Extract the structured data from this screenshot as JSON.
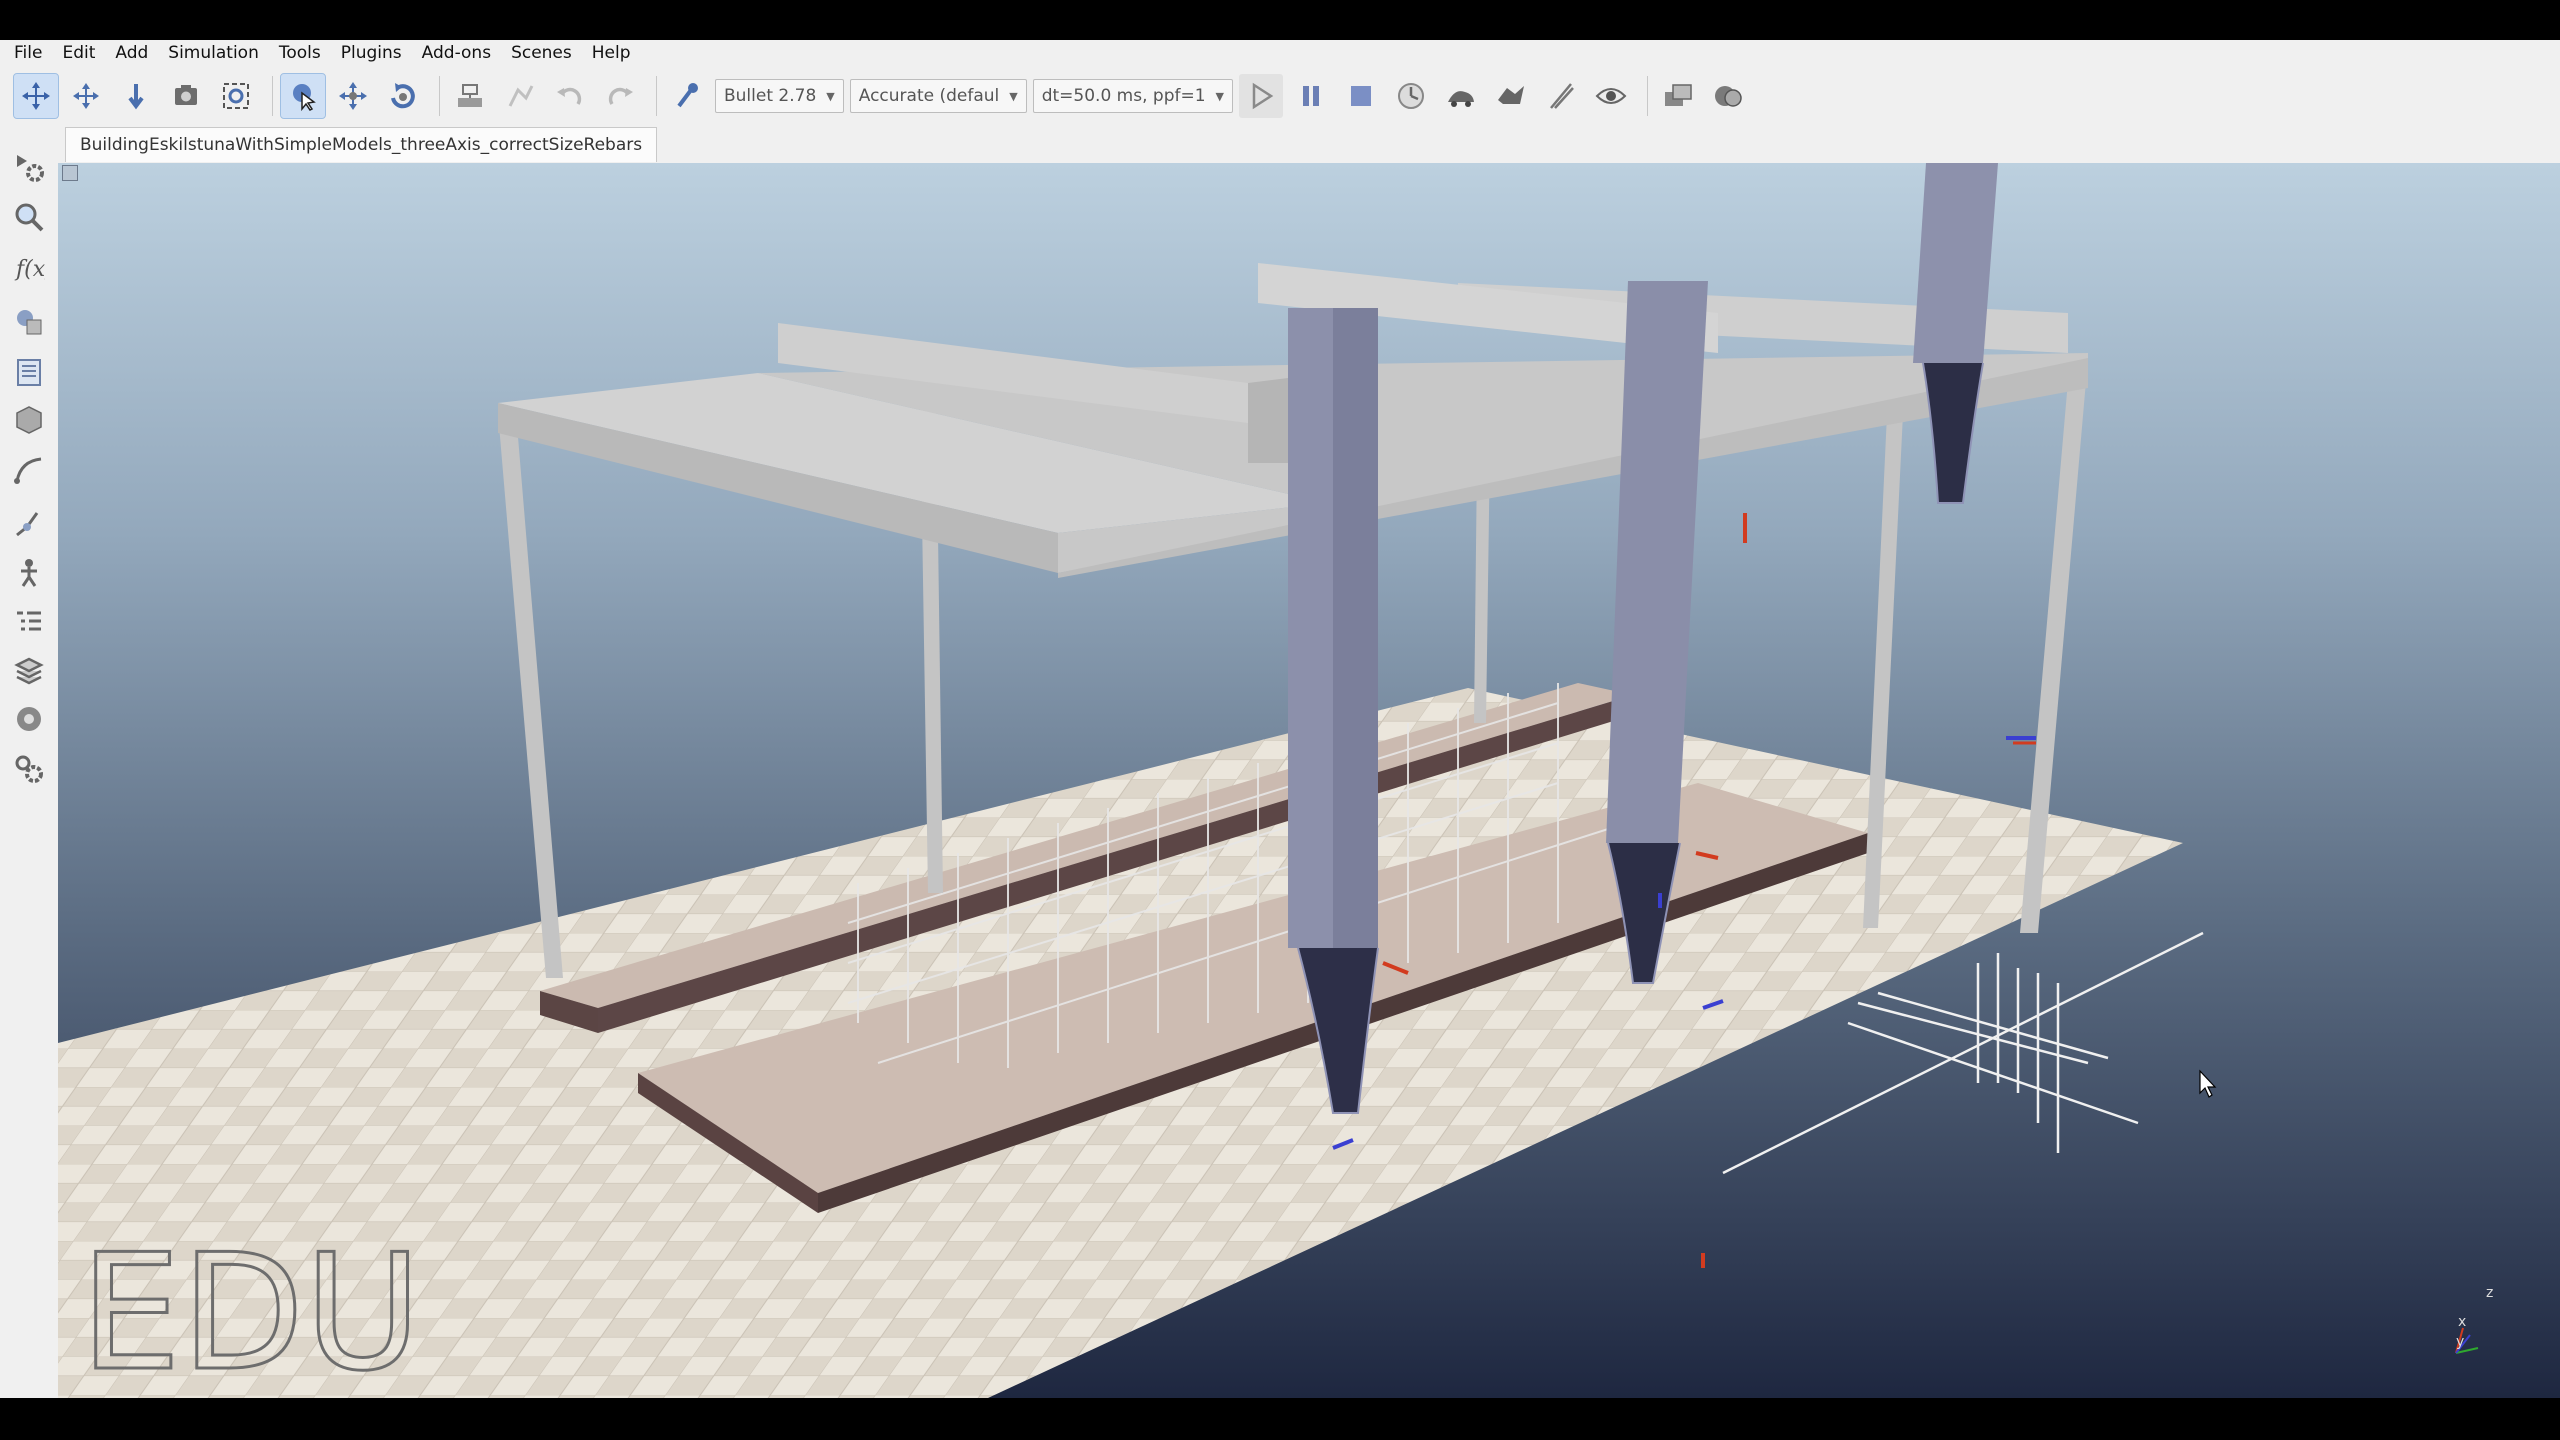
{
  "menu": [
    "File",
    "Edit",
    "Add",
    "Simulation",
    "Tools",
    "Plugins",
    "Add-ons",
    "Scenes",
    "Help"
  ],
  "toolbar": {
    "engine": "Bullet 2.78",
    "accuracy": "Accurate (defaul",
    "timestep": "dt=50.0 ms, ppf=1",
    "icons": [
      "move-camera-icon",
      "pan-camera-icon",
      "zoom-camera-icon",
      "rotate-camera-icon",
      "fit-view-icon",
      "select-icon",
      "translate-object-icon",
      "rotate-object-icon",
      "assemble-icon",
      "transfer-dna-icon",
      "undo-icon",
      "redo-icon",
      "physics-engine-icon",
      "start-simulation-icon",
      "pause-simulation-icon",
      "stop-simulation-icon",
      "realtime-icon",
      "slower-icon",
      "faster-icon",
      "threaded-rendering-icon",
      "toggle-visualization-icon",
      "page-selector-icon",
      "scene-selector-icon"
    ]
  },
  "left_toolbar": {
    "icons": [
      "simulation-settings-icon",
      "model-browser-icon",
      "scene-hierarchy-icon",
      "calculation-modules-icon",
      "collections-icon",
      "shapes-icon",
      "paths-icon",
      "ik-icon",
      "dynamics-icon",
      "geometric-icon",
      "layers-icon",
      "environment-icon",
      "settings-icon"
    ]
  },
  "scene_tab": "BuildingEskilstunaWithSimpleModels_threeAxis_correctSizeRebars",
  "watermark": "EDU",
  "axis_labels": {
    "x": "x",
    "y": "y",
    "z": "z"
  },
  "colors": {
    "toolbar_bg": "#f0f0f0",
    "floor_tile": "#e9e4da",
    "column": "#8e92ad",
    "frame": "#c9c9c9",
    "slab": "#c7b8b0"
  }
}
